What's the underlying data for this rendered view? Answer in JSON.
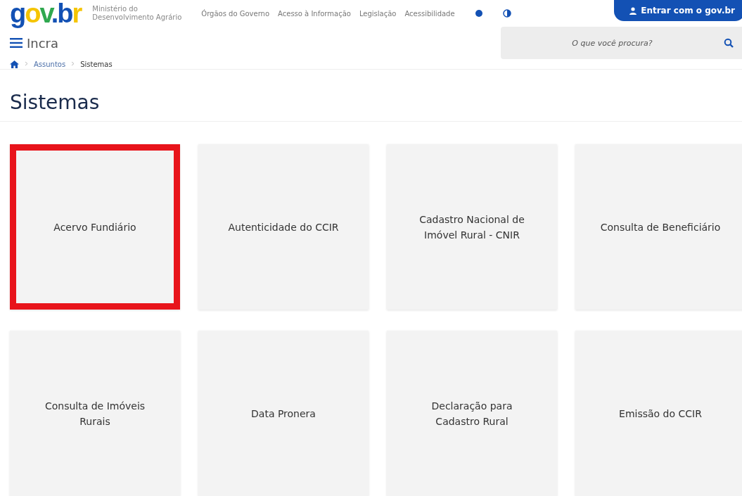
{
  "header": {
    "logo": "gov.br",
    "ministry": [
      "Ministério do",
      "Desenvolvimento Agrário"
    ],
    "links": [
      "Órgãos do Governo",
      "Acesso à Informação",
      "Legislação",
      "Acessibilidade"
    ],
    "login_button": "Entrar com o gov.br"
  },
  "site": {
    "name": "Incra",
    "search": {
      "placeholder": "O que você procura?"
    }
  },
  "breadcrumb": [
    "Assuntos",
    "Sistemas"
  ],
  "page_title": "Sistemas",
  "cards": [
    {
      "label": "Acervo Fundiário",
      "highlighted": true
    },
    {
      "label": "Autenticidade do CCIR",
      "highlighted": false
    },
    {
      "label": "Cadastro Nacional de Imóvel Rural - CNIR",
      "highlighted": false
    },
    {
      "label": "Consulta de Beneficiário",
      "highlighted": false
    },
    {
      "label": "Consulta de Imóveis Rurais",
      "highlighted": false
    },
    {
      "label": "Data Pronera",
      "highlighted": false
    },
    {
      "label": "Declaração para Cadastro Rural",
      "highlighted": false
    },
    {
      "label": "Emissão do CCIR",
      "highlighted": false
    }
  ]
}
